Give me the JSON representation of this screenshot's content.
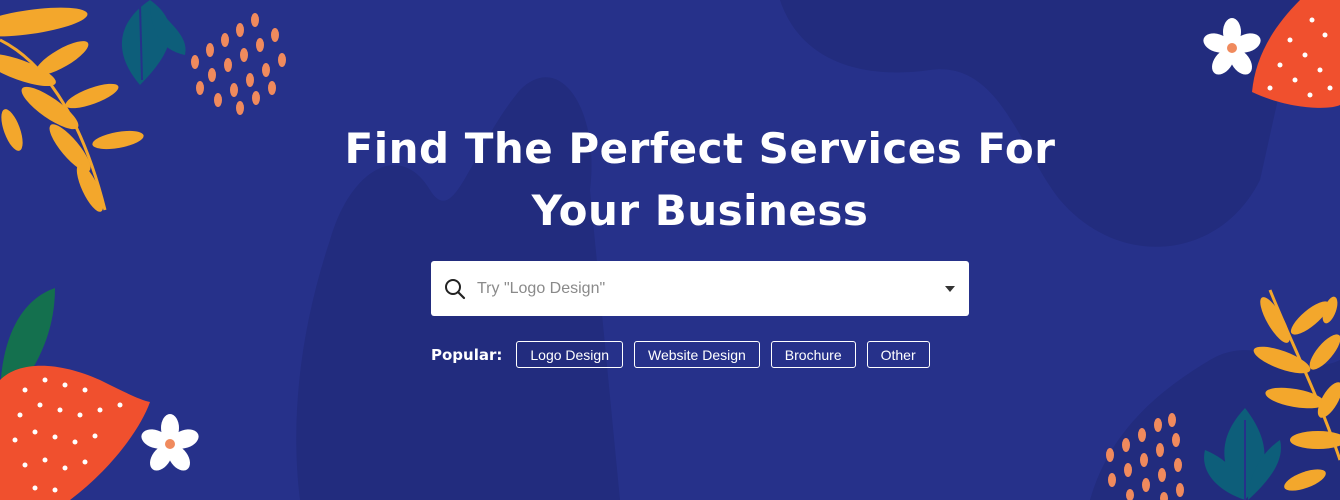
{
  "hero": {
    "title_line1": "Find The Perfect Services For",
    "title_line2": "Your Business"
  },
  "search": {
    "placeholder": "Try \"Logo Design\"",
    "value": "",
    "search_icon": "search-icon",
    "dropdown_icon": "caret-down-icon"
  },
  "popular": {
    "label": "Popular:",
    "tags": [
      "Logo Design",
      "Website Design",
      "Brochure",
      "Other"
    ]
  },
  "colors": {
    "background": "#26318a",
    "blob": "#222c7e",
    "orange_leaf": "#f0502e",
    "yellow_leaf": "#f3a72c",
    "teal_leaf": "#0d5e7a",
    "green_leaf": "#14704e",
    "salmon_dots": "#f08a5d",
    "white": "#ffffff"
  }
}
